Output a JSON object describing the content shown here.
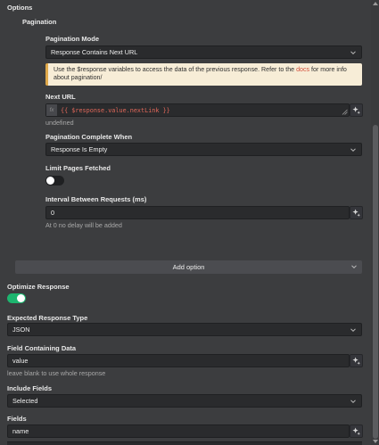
{
  "header": {
    "options_label": "Options",
    "pagination_label": "Pagination"
  },
  "pagination_mode": {
    "label": "Pagination Mode",
    "value": "Response Contains Next URL"
  },
  "notice": {
    "text_before": "Use the $response variables to access the data of the previous response. Refer to the ",
    "link_text": "docs",
    "text_after": " for more info about pagination/"
  },
  "next_url": {
    "label": "Next URL",
    "fx": "fx",
    "expression": "{{ $response.value.nextLink }}",
    "result": "undefined"
  },
  "pagination_complete": {
    "label": "Pagination Complete When",
    "value": "Response Is Empty"
  },
  "limit_pages": {
    "label": "Limit Pages Fetched",
    "enabled": false
  },
  "interval": {
    "label": "Interval Between Requests (ms)",
    "value": "0",
    "hint": "At 0 no delay will be added"
  },
  "add_option": {
    "label": "Add option"
  },
  "optimize": {
    "label": "Optimize Response",
    "enabled": true
  },
  "expected_type": {
    "label": "Expected Response Type",
    "value": "JSON"
  },
  "field_data": {
    "label": "Field Containing Data",
    "value": "value",
    "hint": "leave blank to use whole response"
  },
  "include_fields": {
    "label": "Include Fields",
    "value": "Selected"
  },
  "fields": {
    "label": "Fields",
    "value": "name"
  },
  "colors": {
    "toggle_on": "#1db56f",
    "toggle_off": "#1f2022",
    "notice_bg": "#f7edd7",
    "notice_border": "#e0a94a",
    "link": "#d34f3a",
    "code": "#e2685a"
  },
  "icons": [
    "chevron-down-icon",
    "sparkle-icon",
    "resize-handle-icon"
  ]
}
